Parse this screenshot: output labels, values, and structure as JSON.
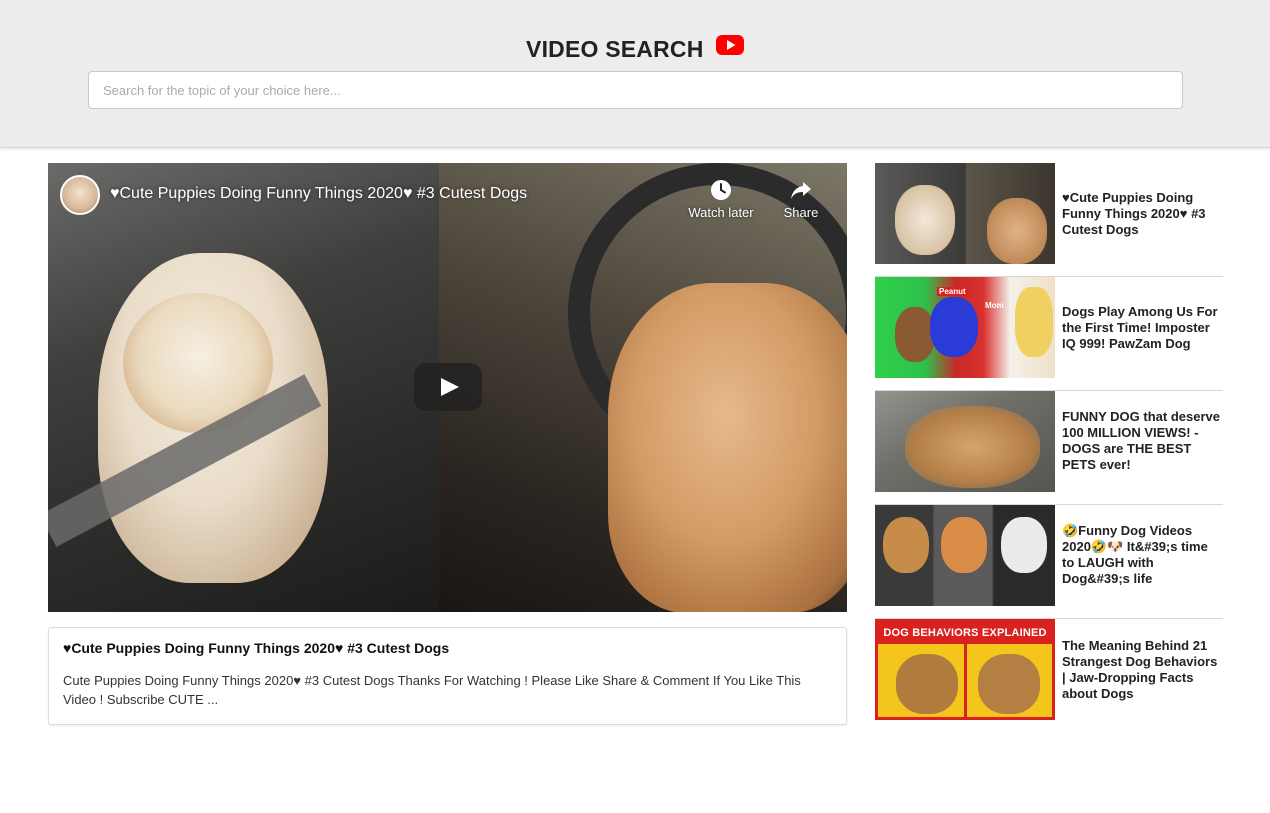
{
  "header": {
    "title": "VIDEO SEARCH",
    "logo_icon": "youtube-icon",
    "logo_color": "#ff0000",
    "background": "#ededed"
  },
  "search": {
    "placeholder": "Search for the topic of your choice here...",
    "value": ""
  },
  "player": {
    "title": "♥Cute Puppies Doing Funny Things 2020♥ #3 Cutest Dogs",
    "watch_later_label": "Watch later",
    "share_label": "Share",
    "watch_later_icon": "clock-icon",
    "share_icon": "share-arrow-icon",
    "play_icon": "play-icon"
  },
  "details": {
    "title": "♥Cute Puppies Doing Funny Things 2020♥ #3 Cutest Dogs",
    "description": "Cute Puppies Doing Funny Things 2020♥ #3 Cutest Dogs Thanks For Watching ! Please Like Share & Comment If You Like This Video ! Subscribe CUTE ..."
  },
  "video_list": [
    {
      "title": "♥Cute Puppies Doing Funny Things 2020♥ #3 Cutest Dogs"
    },
    {
      "title": "Dogs Play Among Us For the First Time! Imposter IQ 999! PawZam Dog",
      "thumb_text_1": "Peanut",
      "thumb_text_2": "Mom"
    },
    {
      "title": "FUNNY DOG that deserve 100 MILLION VIEWS! - DOGS are THE BEST PETS ever!"
    },
    {
      "title": "🤣Funny Dog Videos 2020🤣🐶 It&#39;s time to LAUGH with Dog&#39;s life"
    },
    {
      "title": "The Meaning Behind 21 Strangest Dog Behaviors | Jaw-Dropping Facts about Dogs",
      "thumb_text": "DOG BEHAVIORS EXPLAINED"
    }
  ]
}
